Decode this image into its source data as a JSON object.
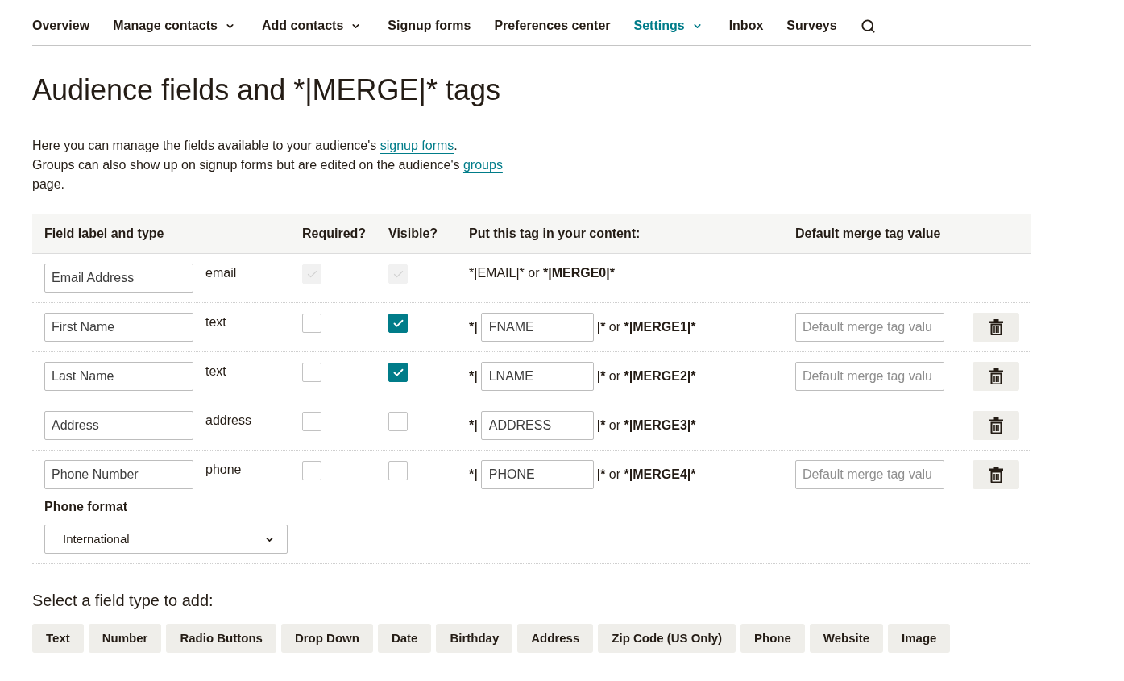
{
  "nav": {
    "items": [
      {
        "label": "Overview",
        "has_menu": false,
        "selected": false
      },
      {
        "label": "Manage contacts",
        "has_menu": true,
        "selected": false
      },
      {
        "label": "Add contacts",
        "has_menu": true,
        "selected": false
      },
      {
        "label": "Signup forms",
        "has_menu": false,
        "selected": false
      },
      {
        "label": "Preferences center",
        "has_menu": false,
        "selected": false
      },
      {
        "label": "Settings",
        "has_menu": true,
        "selected": true
      },
      {
        "label": "Inbox",
        "has_menu": false,
        "selected": false
      },
      {
        "label": "Surveys",
        "has_menu": false,
        "selected": false
      }
    ]
  },
  "title": "Audience fields and *|MERGE|* tags",
  "intro": [
    {
      "parts": [
        {
          "kind": "text",
          "text": "Here you can manage the fields available to your audience's "
        },
        {
          "kind": "link",
          "text": "signup forms"
        },
        {
          "kind": "text",
          "text": "."
        }
      ]
    },
    {
      "parts": [
        {
          "kind": "text",
          "text": "Groups can also show up on signup forms but are edited on the audience's "
        },
        {
          "kind": "link",
          "text": "groups"
        },
        {
          "kind": "text",
          "text": " page."
        }
      ]
    }
  ],
  "table": {
    "columns": [
      "Field label and type",
      "Required?",
      "Visible?",
      "Put this tag in your content:",
      "Default merge tag value"
    ],
    "rows": [
      {
        "label": "Email Address",
        "type": "email",
        "required": true,
        "visible": true,
        "locked": true,
        "tag": {
          "kind": "static",
          "text": "*|EMAIL|*",
          "joiner": "or",
          "merge": "*|MERGE0|*"
        },
        "deletable": false
      },
      {
        "label": "First Name",
        "type": "text",
        "required": false,
        "visible": true,
        "locked": false,
        "tag": {
          "kind": "editable",
          "prefix": "*|",
          "value": "FNAME",
          "suffix": "|*",
          "joiner": "or",
          "merge": "*|MERGE1|*"
        },
        "default_placeholder": "Default merge tag valu",
        "deletable": true
      },
      {
        "label": "Last Name",
        "type": "text",
        "required": false,
        "visible": true,
        "locked": false,
        "tag": {
          "kind": "editable",
          "prefix": "*|",
          "value": "LNAME",
          "suffix": "|*",
          "joiner": "or",
          "merge": "*|MERGE2|*"
        },
        "default_placeholder": "Default merge tag valu",
        "deletable": true
      },
      {
        "label": "Address",
        "type": "address",
        "required": false,
        "visible": false,
        "locked": false,
        "tag": {
          "kind": "editable",
          "prefix": "*|",
          "value": "ADDRESS",
          "suffix": "|*",
          "joiner": "or",
          "merge": "*|MERGE3|*"
        },
        "deletable": true
      },
      {
        "label": "Phone Number",
        "type": "phone",
        "required": false,
        "visible": false,
        "locked": false,
        "tag": {
          "kind": "editable",
          "prefix": "*|",
          "value": "PHONE",
          "suffix": "|*",
          "joiner": "or",
          "merge": "*|MERGE4|*"
        },
        "default_placeholder": "Default merge tag valu",
        "deletable": true,
        "phone_format": {
          "label": "Phone format",
          "value": "International"
        }
      }
    ]
  },
  "add_field": {
    "heading": "Select a field type to add:",
    "buttons": [
      "Text",
      "Number",
      "Radio Buttons",
      "Drop Down",
      "Date",
      "Birthday",
      "Address",
      "Zip Code (US Only)",
      "Phone",
      "Website",
      "Image"
    ]
  }
}
